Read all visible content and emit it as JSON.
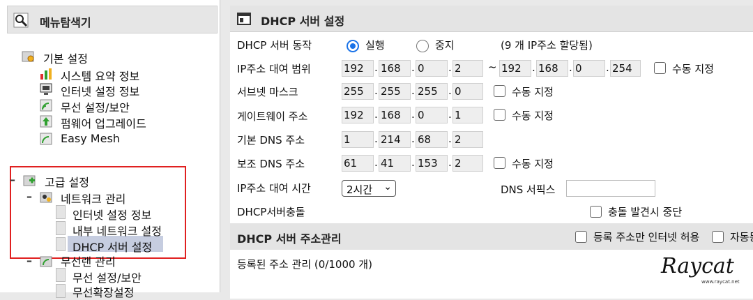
{
  "left": {
    "title": "메뉴탐색기",
    "basic": {
      "label": "기본 설정",
      "items": [
        "시스템 요약 정보",
        "인터넷 설정 정보",
        "무선 설정/보안",
        "펌웨어 업그레이드",
        "Easy Mesh"
      ]
    },
    "advanced": {
      "label": "고급 설정",
      "network": {
        "label": "네트워크 관리",
        "items": [
          "인터넷 설정 정보",
          "내부 네트워크 설정",
          "DHCP 서버 설정"
        ]
      },
      "wireless": {
        "label": "무선랜 관리",
        "items": [
          "무선 설정/보안",
          "무선확장설정"
        ]
      }
    }
  },
  "main": {
    "title": "DHCP 서버 설정",
    "action": {
      "label": "DHCP 서버 동작",
      "run": "실행",
      "stop": "중지",
      "note": "(9 개 IP주소 할당됨)"
    },
    "range": {
      "label": "IP주소 대여 범위",
      "start": [
        "192",
        "168",
        "0",
        "2"
      ],
      "tilde": "~",
      "end": [
        "192",
        "168",
        "0",
        "254"
      ],
      "manual": "수동 지정"
    },
    "subnet": {
      "label": "서브넷 마스크",
      "ip": [
        "255",
        "255",
        "255",
        "0"
      ],
      "manual": "수동 지정"
    },
    "gateway": {
      "label": "게이트웨이 주소",
      "ip": [
        "192",
        "168",
        "0",
        "1"
      ],
      "manual": "수동 지정"
    },
    "dns1": {
      "label": "기본 DNS 주소",
      "ip": [
        "1",
        "214",
        "68",
        "2"
      ]
    },
    "dns2": {
      "label": "보조 DNS 주소",
      "ip": [
        "61",
        "41",
        "153",
        "2"
      ],
      "manual": "수동 지정"
    },
    "lease": {
      "label": "IP주소 대여 시간",
      "value": "2시간",
      "dns_suffix_label": "DNS 서픽스",
      "dns_suffix_value": ""
    },
    "conflict": {
      "label": "DHCP서버충돌",
      "stop_label": "충돌 발견시 중단"
    },
    "address_mgmt": {
      "title": "DHCP 서버 주소관리",
      "registered_only": "등록 주소만 인터넷 허용",
      "auto": "자동등",
      "registered": "등록된 주소 관리 (0/1000 개)"
    }
  },
  "watermark": {
    "brand": "Raycat",
    "url": "www.raycat.net"
  },
  "colors": {
    "accent": "#1a73e8",
    "highlight_border": "#e02020",
    "selected_bg": "#c6cde0"
  }
}
